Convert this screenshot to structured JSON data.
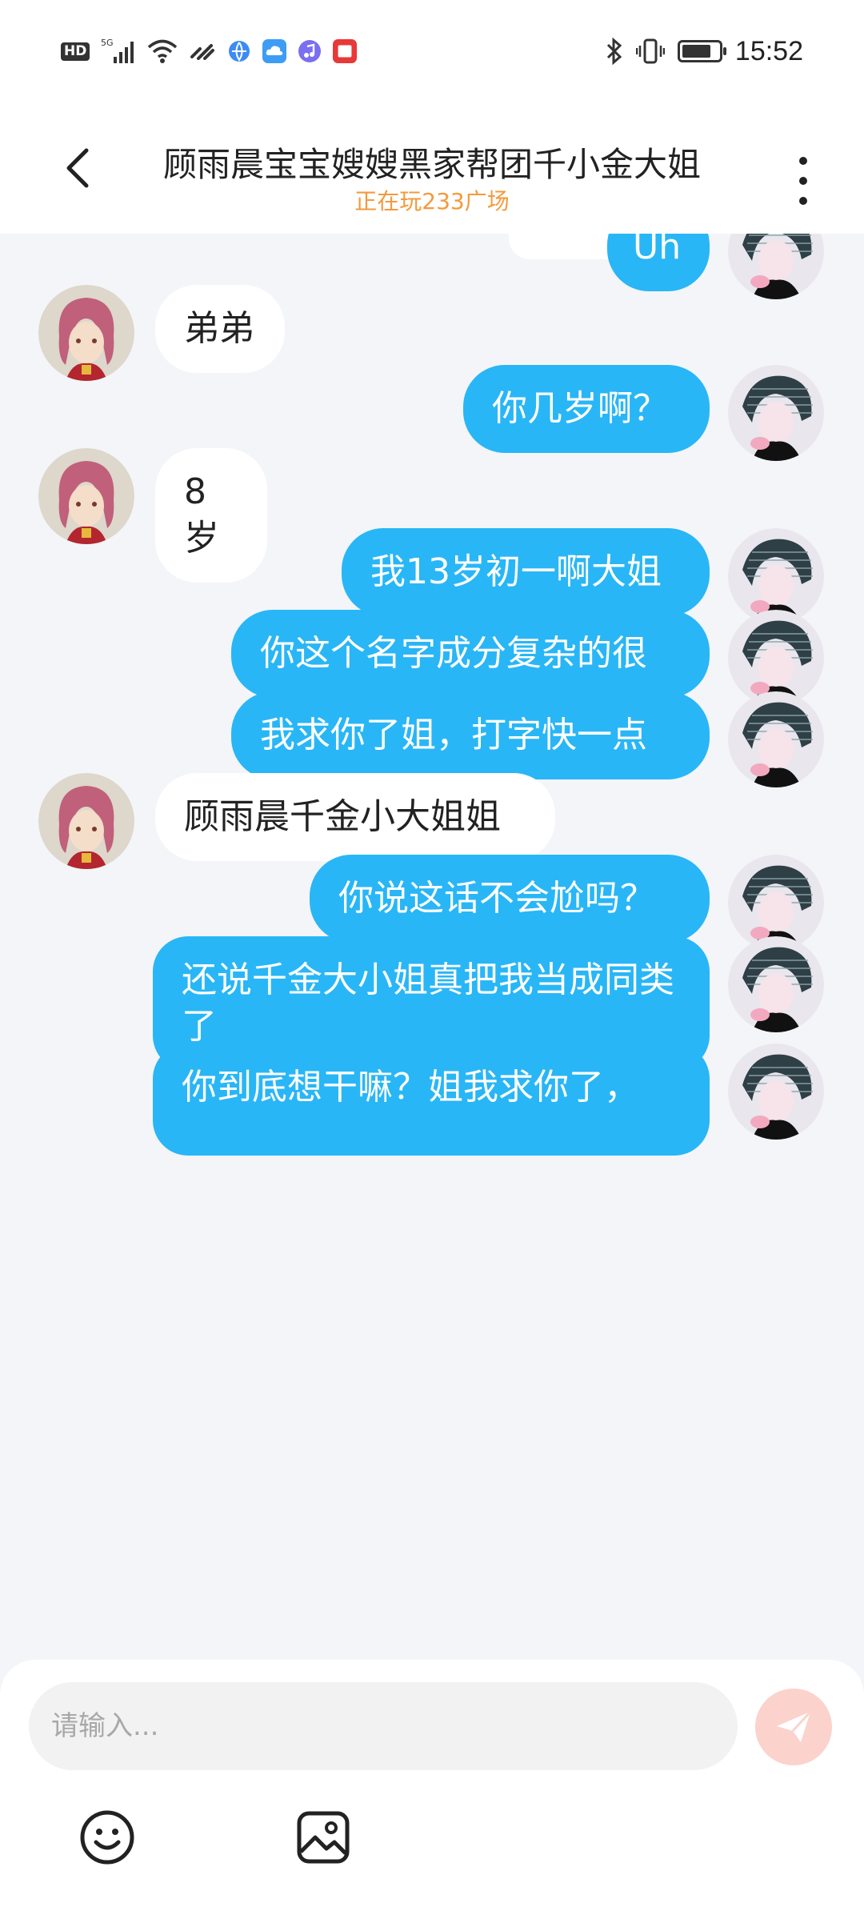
{
  "status_bar": {
    "network_label": "HD",
    "signal_label": "5G",
    "time": "15:52",
    "battery_percent": 80,
    "app_badge_colors": [
      "#3d8bf5",
      "#3d9df5",
      "#7a6ff0",
      "#e83838"
    ]
  },
  "header": {
    "title": "顾雨晨宝宝嫂嫂黑家帮团千小金大姐",
    "subtitle": "正在玩233广场",
    "subtitle_color": "#f39a3c"
  },
  "messages": [
    {
      "side": "me",
      "text": "Uh"
    },
    {
      "side": "other",
      "text": "弟弟"
    },
    {
      "side": "me",
      "text": "你几岁啊？"
    },
    {
      "side": "other",
      "text": "8岁"
    },
    {
      "side": "me",
      "text": "我13岁初一啊大姐"
    },
    {
      "side": "me",
      "text": "你这个名字成分复杂的很"
    },
    {
      "side": "me",
      "text": "我求你了姐，打字快一点"
    },
    {
      "side": "other",
      "text": "顾雨晨千金小大姐姐"
    },
    {
      "side": "me",
      "text": "你说这话不会尬吗？"
    },
    {
      "side": "me",
      "text": "还说千金大小姐真把我当成同类了"
    },
    {
      "side": "me",
      "text": "你到底想干嘛？姐我求你了，"
    }
  ],
  "input": {
    "placeholder": "请输入..."
  },
  "toolbar": {
    "emoji_icon": "smiley-icon",
    "image_icon": "image-icon",
    "send_icon": "paper-plane-icon"
  },
  "colors": {
    "my_bubble": "#29b6f6",
    "other_bubble": "#ffffff",
    "background": "#f3f5f8",
    "send_button": "#fbd3cc"
  }
}
